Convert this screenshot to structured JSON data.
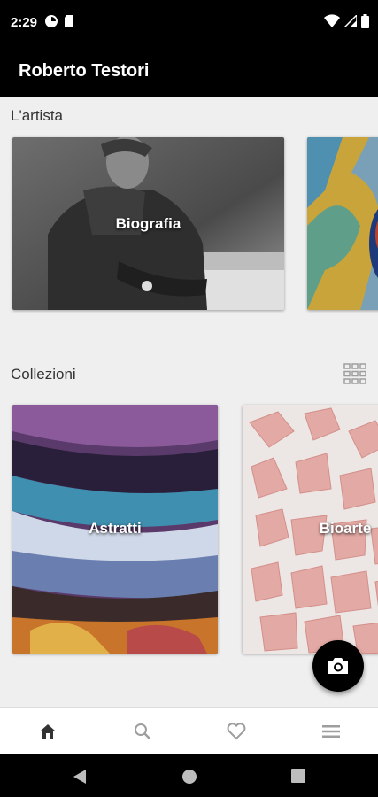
{
  "status_bar": {
    "time": "2:29",
    "left_icons": [
      "notification-app-icon",
      "sd-card-icon"
    ],
    "right_icons": [
      "wifi-icon",
      "cell-signal-icon",
      "battery-icon"
    ]
  },
  "app_bar": {
    "title": "Roberto Testori"
  },
  "sections": {
    "artist": {
      "title": "L'artista",
      "cards": [
        {
          "label": "Biografia"
        },
        {
          "label": ""
        }
      ]
    },
    "collections": {
      "title": "Collezioni",
      "view_toggle_icon": "grid-view-icon",
      "cards": [
        {
          "label": "Astratti"
        },
        {
          "label": "Bioarte"
        }
      ]
    }
  },
  "fab": {
    "icon": "camera-icon"
  },
  "bottom_nav": {
    "items": [
      {
        "icon": "home-icon",
        "active": true
      },
      {
        "icon": "search-icon",
        "active": false
      },
      {
        "icon": "heart-icon",
        "active": false
      },
      {
        "icon": "menu-icon",
        "active": false
      }
    ]
  },
  "system_nav": [
    "back-icon",
    "home-circle-icon",
    "recents-icon"
  ],
  "colors": {
    "app_bar": "#000000",
    "background": "#efefef",
    "active_nav": "#333333",
    "inactive_nav": "#9e9e9e"
  }
}
